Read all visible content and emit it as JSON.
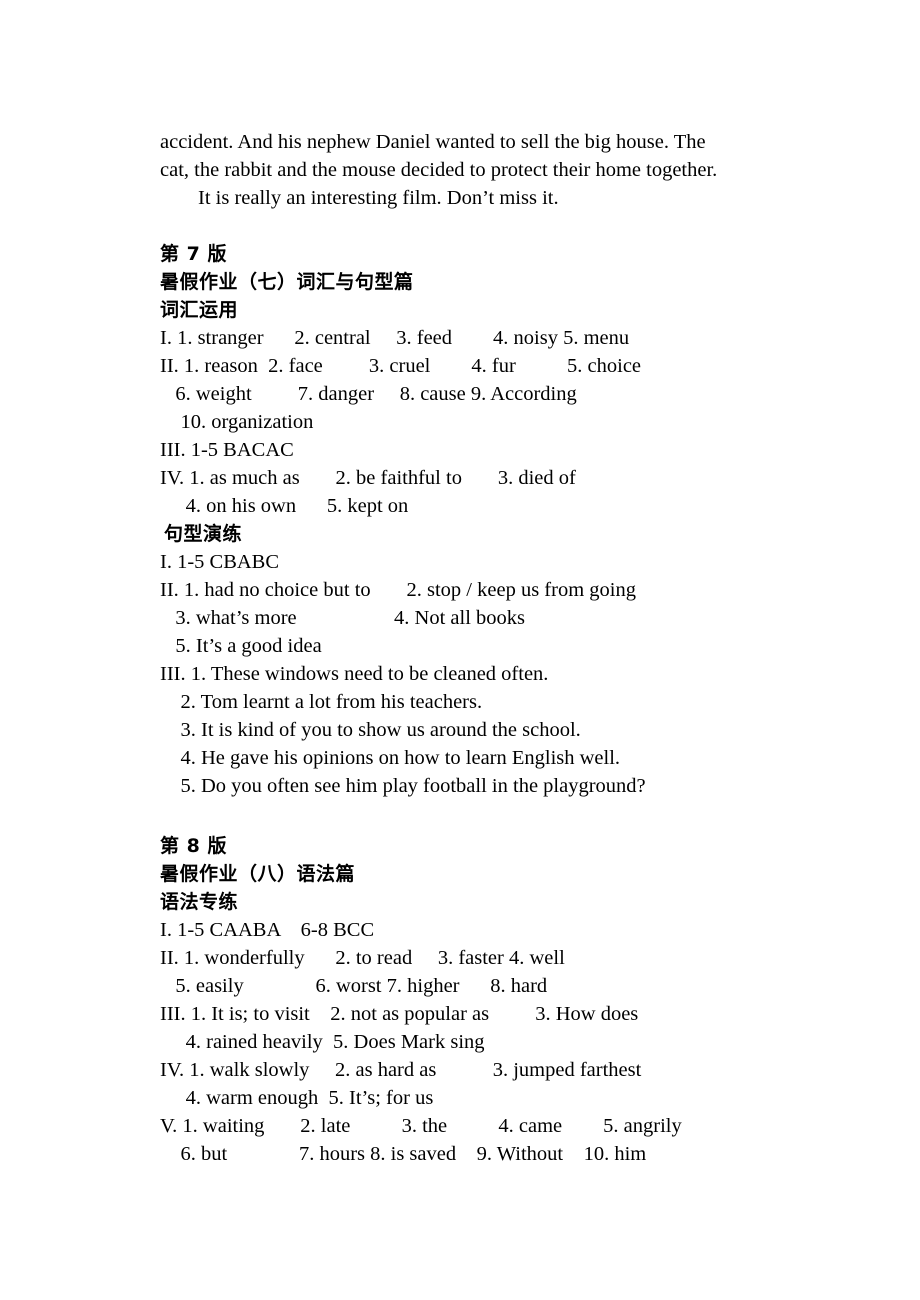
{
  "document": {
    "intro_paragraph": {
      "line1": "accident. And his nephew Daniel wanted to sell the big house. The",
      "line2": "cat, the rabbit and the mouse decided to protect their home together.",
      "line3": "It is really an interesting film. Don’t miss it."
    },
    "sections": [
      {
        "page_label": "第 7 版",
        "title": "暑假作业（七）词汇与句型篇",
        "subsections": [
          {
            "heading": "词汇运用",
            "lines": [
              "I. 1. stranger      2. central     3. feed        4. noisy 5. menu",
              "II. 1. reason  2. face         3. cruel        4. fur          5. choice",
              "   6. weight         7. danger     8. cause 9. According",
              "    10. organization",
              "III. 1-5 BACAC",
              "IV. 1. as much as       2. be faithful to       3. died of",
              "     4. on his own      5. kept on"
            ]
          },
          {
            "heading": "句型演练",
            "lines": [
              "I. 1-5 CBABC",
              "II. 1. had no choice but to       2. stop / keep us from going",
              "   3. what’s more                   4. Not all books",
              "   5. It’s a good idea",
              "III. 1. These windows need to be cleaned often.",
              "    2. Tom learnt a lot from his teachers.",
              "    3. It is kind of you to show us around the school.",
              "    4. He gave his opinions on how to learn English well.",
              "    5. Do you often see him play football in the playground?"
            ]
          }
        ]
      },
      {
        "page_label": "第 8 版",
        "title": "暑假作业（八）语法篇",
        "subsections": [
          {
            "heading": "语法专练",
            "lines": [
              "I. 1-5 CAABA    6-8 BCC",
              "II. 1. wonderfully      2. to read     3. faster 4. well",
              "   5. easily              6. worst 7. higher      8. hard",
              "III. 1. It is; to visit    2. not as popular as         3. How does",
              "     4. rained heavily  5. Does Mark sing",
              "IV. 1. walk slowly     2. as hard as           3. jumped farthest",
              "     4. warm enough  5. It’s; for us",
              "V. 1. waiting       2. late          3. the          4. came        5. angrily",
              "    6. but              7. hours 8. is saved    9. Without    10. him"
            ]
          }
        ]
      }
    ]
  }
}
